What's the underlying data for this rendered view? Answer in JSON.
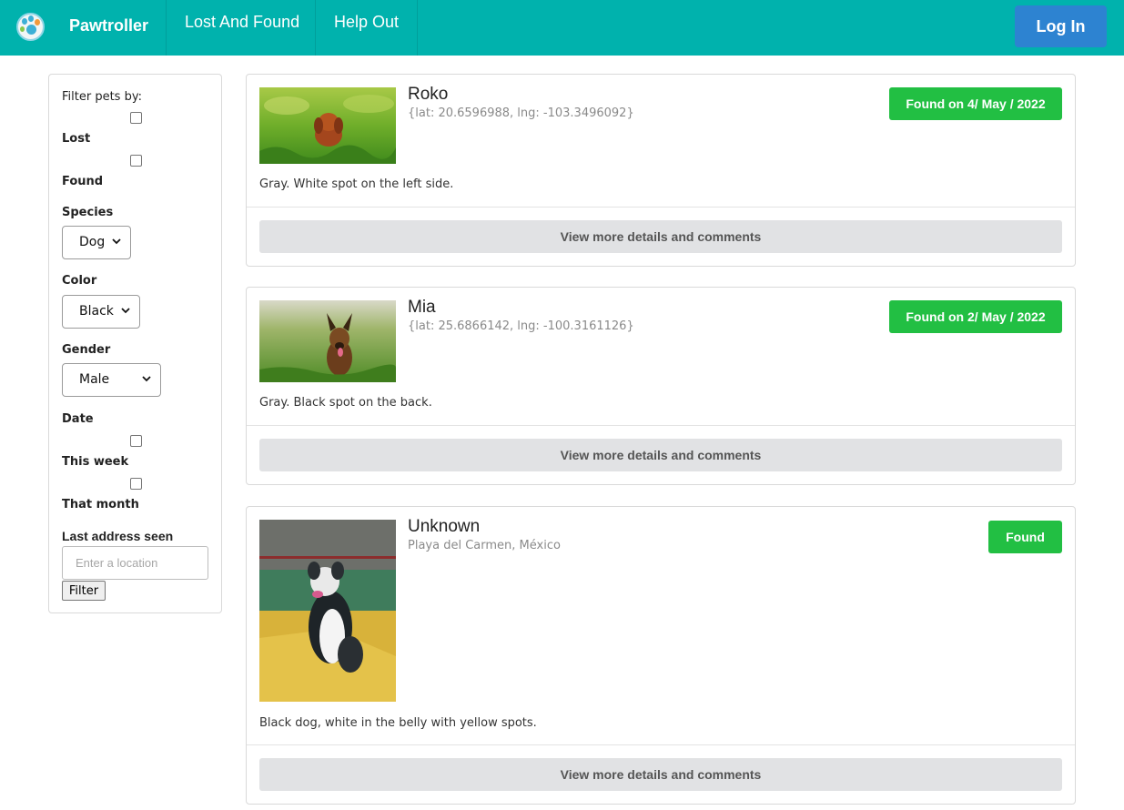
{
  "nav": {
    "brand": "Pawtroller",
    "links": [
      "Lost And Found",
      "Help Out"
    ],
    "login_label": "Log In",
    "logo_icon": "paw-logo-icon",
    "accent_color": "#00b2ad",
    "login_color": "#2d83d1"
  },
  "filters": {
    "heading": "Filter pets by:",
    "status_options": [
      {
        "label": "Lost",
        "checked": false
      },
      {
        "label": "Found",
        "checked": false
      }
    ],
    "species": {
      "label": "Species",
      "value": "Dog"
    },
    "color": {
      "label": "Color",
      "value": "Black"
    },
    "gender": {
      "label": "Gender",
      "value": "Male"
    },
    "date": {
      "label": "Date",
      "options": [
        {
          "label": "This week",
          "checked": false
        },
        {
          "label": "That month",
          "checked": false
        }
      ]
    },
    "address": {
      "label": "Last address seen",
      "placeholder": "Enter a location",
      "value": ""
    },
    "submit_label": "Filter"
  },
  "pets": [
    {
      "name": "Roko",
      "location": "{lat: 20.6596988, lng: -103.3496092}",
      "status": "Found on 4/ May / 2022",
      "description": "Gray. White spot on the left side.",
      "details_label": "View more details and comments",
      "photo": "dog-photo-roko"
    },
    {
      "name": "Mia",
      "location": "{lat: 25.6866142, lng: -100.3161126}",
      "status": "Found on 2/ May / 2022",
      "description": "Gray. Black spot on the back.",
      "details_label": "View more details and comments",
      "photo": "dog-photo-mia"
    },
    {
      "name": "Unknown",
      "location": "Playa del Carmen, México",
      "status": "Found",
      "description": "Black dog, white in the belly with yellow spots.",
      "details_label": "View more details and comments",
      "photo": "dog-photo-unknown"
    }
  ],
  "status_color": "#22bf43"
}
